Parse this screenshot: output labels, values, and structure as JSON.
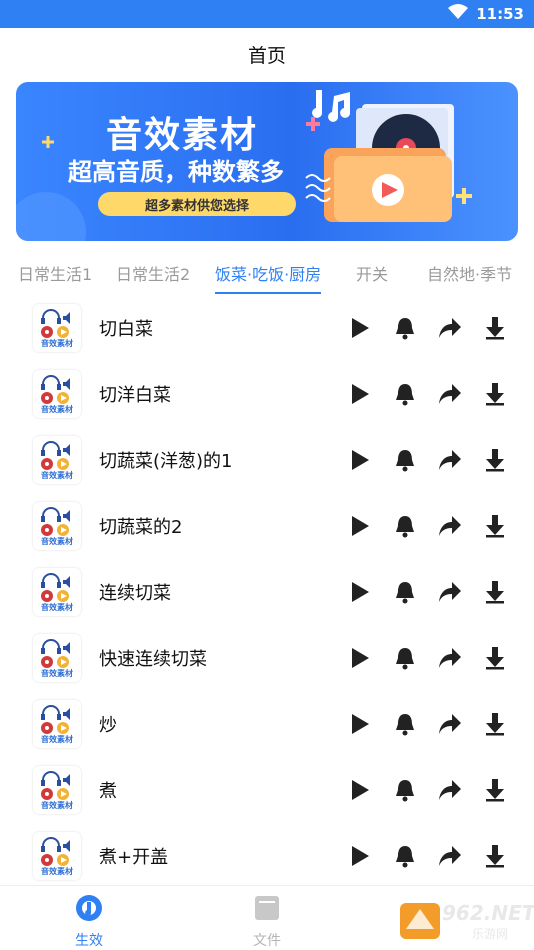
{
  "status_bar": {
    "time": "11:53"
  },
  "header": {
    "title": "首页"
  },
  "banner": {
    "headline": "音效素材",
    "subline": "超高音质，种数繁多",
    "tag": "超多素材供您选择"
  },
  "tabs": [
    {
      "label": "日常生活1",
      "active": false
    },
    {
      "label": "日常生活2",
      "active": false
    },
    {
      "label": "饭菜·吃饭·厨房",
      "active": true
    },
    {
      "label": "开关",
      "active": false
    },
    {
      "label": "自然地·季节",
      "active": false
    }
  ],
  "thumb_label": "音效素材",
  "items": [
    {
      "name": "切白菜"
    },
    {
      "name": "切洋白菜"
    },
    {
      "name": "切蔬菜(洋葱)的1"
    },
    {
      "name": "切蔬菜的2"
    },
    {
      "name": "连续切菜"
    },
    {
      "name": "快速连续切菜"
    },
    {
      "name": "炒"
    },
    {
      "name": "煮"
    },
    {
      "name": "煮+开盖"
    }
  ],
  "bottom_nav": [
    {
      "label": "生效",
      "active": true,
      "icon": "music-disc-icon"
    },
    {
      "label": "文件",
      "active": false,
      "icon": "folder-icon"
    }
  ],
  "watermark": {
    "text": "962.NET",
    "subtext": "乐游网"
  },
  "colors": {
    "accent": "#2f80f3",
    "icon": "#222222",
    "inactive": "#9a9a9a"
  }
}
